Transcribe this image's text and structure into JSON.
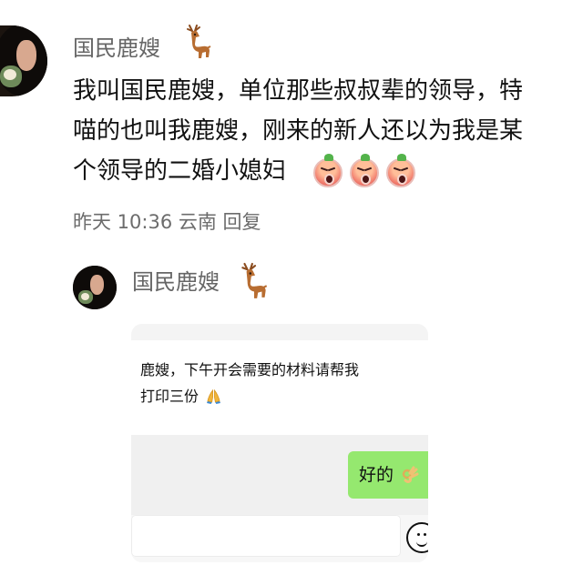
{
  "post": {
    "author": "国民鹿嫂",
    "author_icon": "deer-icon",
    "text_lines": [
      "我叫国民鹿嫂，单位那些叔叔辈的领导，特",
      "喵的也叫我鹿嫂，刚来的新人还以为我是某",
      "个领导的二婚小媳妇"
    ],
    "reaction_icons": [
      "angry-face-icon",
      "angry-face-icon",
      "angry-face-icon"
    ],
    "meta": "昨天 10:36 云南 回复"
  },
  "reply": {
    "author": "国民鹿嫂",
    "author_icon": "deer-icon",
    "chat": {
      "incoming_lines": [
        "鹿嫂，下午开会需要的材料请帮我",
        "打印三份"
      ],
      "incoming_icon": "pray-hands-icon",
      "outgoing_text": "好的",
      "outgoing_icon": "ok-hand-icon",
      "composer_icon": "emoji-icon"
    }
  },
  "colors": {
    "outgoing_bubble": "#95e86f",
    "name_text": "#666666",
    "meta_text": "#6c6c6c"
  }
}
